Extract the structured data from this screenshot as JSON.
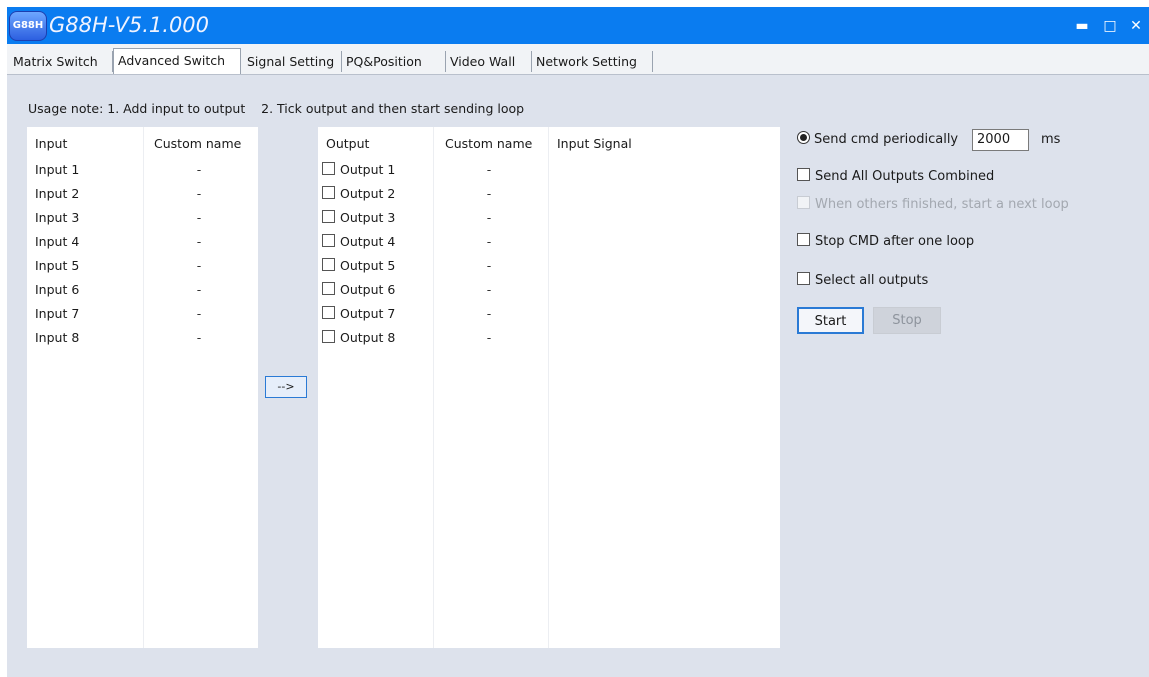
{
  "window": {
    "logo_text": "G88H",
    "title": "G88H-V5.1.000",
    "minimize_glyph": "▬",
    "maximize_glyph": "□",
    "close_glyph": "✕"
  },
  "tabs": [
    {
      "label": "Matrix Switch",
      "active": false
    },
    {
      "label": "Advanced Switch",
      "active": true
    },
    {
      "label": "Signal Setting",
      "active": false
    },
    {
      "label": "PQ&Position",
      "active": false
    },
    {
      "label": "Video Wall",
      "active": false
    },
    {
      "label": "Network Setting",
      "active": false
    }
  ],
  "usage_note": "Usage note: 1. Add input to output    2. Tick output and then start sending loop",
  "inputs_panel": {
    "col_input": "Input",
    "col_custom": "Custom name",
    "rows": [
      {
        "name": "Input  1",
        "custom": "-"
      },
      {
        "name": "Input  2",
        "custom": "-"
      },
      {
        "name": "Input  3",
        "custom": "-"
      },
      {
        "name": "Input  4",
        "custom": "-"
      },
      {
        "name": "Input  5",
        "custom": "-"
      },
      {
        "name": "Input  6",
        "custom": "-"
      },
      {
        "name": "Input  7",
        "custom": "-"
      },
      {
        "name": "Input  8",
        "custom": "-"
      }
    ]
  },
  "add_button_label": "-->",
  "outputs_panel": {
    "col_output": "Output",
    "col_custom": "Custom name",
    "col_signal": "Input Signal",
    "rows": [
      {
        "name": "Output  1",
        "custom": "-",
        "checked": false
      },
      {
        "name": "Output  2",
        "custom": "-",
        "checked": false
      },
      {
        "name": "Output  3",
        "custom": "-",
        "checked": false
      },
      {
        "name": "Output  4",
        "custom": "-",
        "checked": false
      },
      {
        "name": "Output  5",
        "custom": "-",
        "checked": false
      },
      {
        "name": "Output  6",
        "custom": "-",
        "checked": false
      },
      {
        "name": "Output  7",
        "custom": "-",
        "checked": false
      },
      {
        "name": "Output  8",
        "custom": "-",
        "checked": false
      }
    ]
  },
  "options": {
    "send_periodically": "Send cmd periodically",
    "period_value": "2000",
    "period_unit": "ms",
    "send_combined": "Send All Outputs Combined",
    "next_loop": "When others finished, start a next loop",
    "stop_after_loop": "Stop CMD after one loop",
    "select_all": "Select all outputs",
    "start_label": "Start",
    "stop_label": "Stop"
  }
}
